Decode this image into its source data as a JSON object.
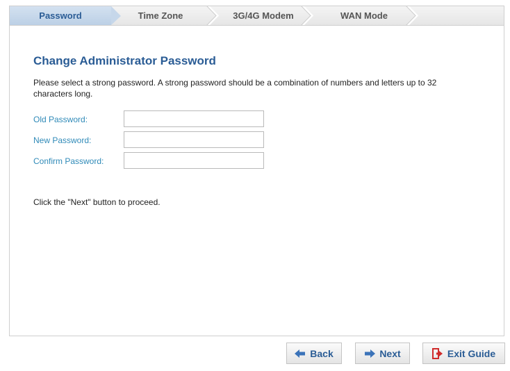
{
  "wizard": {
    "steps": [
      {
        "label": "Password",
        "active": true
      },
      {
        "label": "Time Zone",
        "active": false
      },
      {
        "label": "3G/4G Modem",
        "active": false
      },
      {
        "label": "WAN Mode",
        "active": false
      }
    ]
  },
  "main": {
    "title": "Change Administrator Password",
    "description": "Please select a strong password. A strong password should be a combination of numbers and letters up to 32 characters long.",
    "fields": {
      "old_password": {
        "label": "Old Password:",
        "value": ""
      },
      "new_password": {
        "label": "New Password:",
        "value": ""
      },
      "confirm_password": {
        "label": "Confirm Password:",
        "value": ""
      }
    },
    "proceed_text": "Click the \"Next\" button to proceed."
  },
  "buttons": {
    "back": {
      "label": "Back",
      "icon": "arrow-left-icon"
    },
    "next": {
      "label": "Next",
      "icon": "arrow-right-icon"
    },
    "exit": {
      "label": "Exit Guide",
      "icon": "exit-door-icon"
    }
  },
  "colors": {
    "accent": "#2a5c95",
    "label_blue": "#2f8ab8",
    "exit_red": "#d02b2b"
  }
}
